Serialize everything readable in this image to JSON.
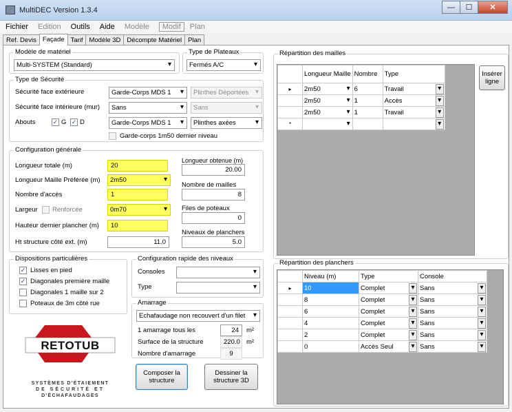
{
  "window": {
    "title": "MultiDEC Version 1.3.4"
  },
  "menu": [
    "Fichier",
    "Edition",
    "Outils",
    "Aide",
    "Modèle",
    "Modif",
    "Plan"
  ],
  "tabs": [
    "Ref. Devis",
    "Façade",
    "Tarif",
    "Modèle 3D",
    "Décompte Matériel",
    "Plan"
  ],
  "modele": {
    "legend": "Modèle de matériel",
    "value": "Multi-SYSTEM (Standard)"
  },
  "plateaux": {
    "legend": "Type de Plateaux",
    "value": "Fermés A/C"
  },
  "securite": {
    "legend": "Type de Sécurité",
    "ext_label": "Sécurité face extérieure",
    "ext_value": "Garde-Corps MDS 1",
    "ext_plinthe": "Plinthes Déportées",
    "int_label": "Sécurité face intérieure (mur)",
    "int_value": "Sans",
    "int_plinthe": "Sans",
    "abouts_label": "Abouts",
    "g_label": "G",
    "d_label": "D",
    "abouts_value": "Garde-Corps MDS 1",
    "abouts_plinthe": "Plinthes axées",
    "gc_label": "Garde-corps 1m50 dernier niveau"
  },
  "config": {
    "legend": "Configuration générale",
    "lt_label": "Longueur totale (m)",
    "lt_value": "20",
    "lmp_label": "Longueur Maille Préférée (m)",
    "lmp_value": "2m50",
    "acces_label": "Nombre d'accès",
    "acces_value": "1",
    "largeur_label": "Largeur",
    "renforcee_label": "Renforcée",
    "largeur_value": "0m70",
    "hdp_label": "Hauteur dernier plancher (m)",
    "hdp_value": "10",
    "ht_label": "Ht structure côté ext. (m)",
    "ht_value": "11.0",
    "lo_label": "Longueur obtenue (m)",
    "lo_value": "20.00",
    "nm_label": "Nombre de mailles",
    "nm_value": "8",
    "fp_label": "Files de poteaux",
    "fp_value": "0",
    "np_label": "Niveaux de planchers",
    "np_value": "5.0"
  },
  "dispositions": {
    "legend": "Dispositions particulières",
    "items": [
      {
        "label": "Lisses en pied",
        "checked": "✓"
      },
      {
        "label": "Diagonales première maille",
        "checked": "✓"
      },
      {
        "label": "Diagonales 1 maille sur 2",
        "checked": ""
      },
      {
        "label": "Poteaux de 3m côté rue",
        "checked": ""
      }
    ]
  },
  "rapide": {
    "legend": "Configuration rapide des niveaux",
    "consoles_label": "Consoles",
    "type_label": "Type"
  },
  "amarrage": {
    "legend": "Amarrage",
    "value": "Echafaudage non recouvert d'un filet",
    "tous_label": "1 amarrage tous les",
    "tous_value": "24",
    "tous_unit": "m²",
    "surface_label": "Surface de la structure",
    "surface_value": "220.0",
    "surface_unit": "m²",
    "nombre_label": "Nombre d'amarrage",
    "nombre_value": "9"
  },
  "buttons": {
    "composer": "Composer la structure",
    "dessiner": "Dessiner la structure 3D",
    "inserer": "Insérer ligne"
  },
  "logo": {
    "name": "RETOTUB",
    "line1": "SYSTÈMES D'ÉTAIEMENT",
    "line2": "DE SÉCURITÉ ET",
    "line3": "D'ÉCHAFAUDAGES"
  },
  "mailles": {
    "legend": "Répartition des mailles",
    "headers": [
      "Longueur Maille",
      "Nombre",
      "Type"
    ],
    "rows": [
      {
        "longueur": "2m50",
        "nombre": "6",
        "type": "Travail"
      },
      {
        "longueur": "2m50",
        "nombre": "1",
        "type": "Accès"
      },
      {
        "longueur": "2m50",
        "nombre": "1",
        "type": "Travail"
      }
    ]
  },
  "planchers": {
    "legend": "Répartition des planchers",
    "headers": [
      "Niveau (m)",
      "Type",
      "Console"
    ],
    "rows": [
      {
        "niveau": "10",
        "type": "Complet",
        "console": "Sans"
      },
      {
        "niveau": "8",
        "type": "Complet",
        "console": "Sans"
      },
      {
        "niveau": "6",
        "type": "Complet",
        "console": "Sans"
      },
      {
        "niveau": "4",
        "type": "Complet",
        "console": "Sans"
      },
      {
        "niveau": "2",
        "type": "Complet",
        "console": "Sans"
      },
      {
        "niveau": "0",
        "type": "Accès Seul",
        "console": "Sans"
      }
    ]
  }
}
